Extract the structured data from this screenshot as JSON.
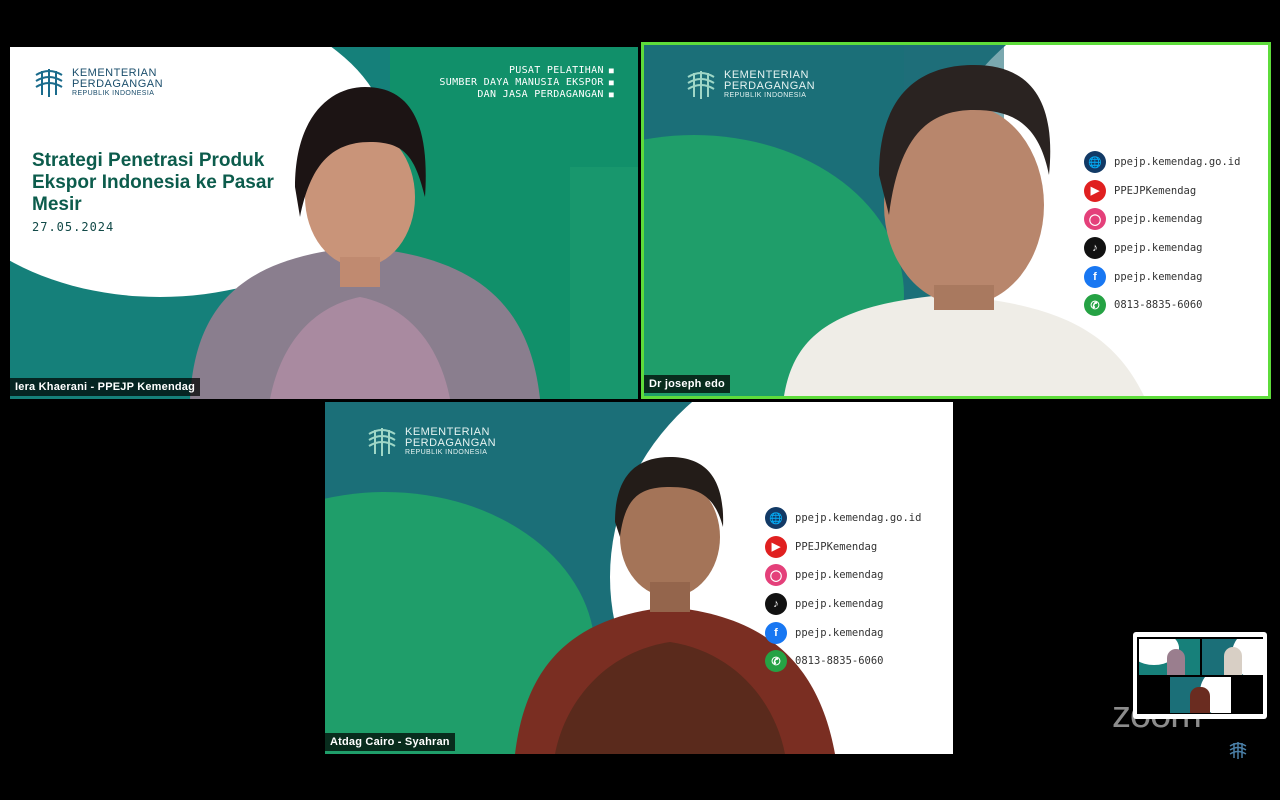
{
  "tiles": {
    "presenter": {
      "name": "Iera Khaerani - PPEJP Kemendag",
      "logo": {
        "line1": "KEMENTERIAN",
        "line2": "PERDAGANGAN",
        "line3": "REPUBLIK INDONESIA"
      },
      "pusat": [
        "PUSAT PELATIHAN",
        "SUMBER DAYA MANUSIA EKSPOR",
        "DAN JASA PERDAGANGAN"
      ],
      "title": [
        "Strategi Penetrasi Produk",
        "Ekspor Indonesia ke Pasar",
        "Mesir"
      ],
      "date": "27.05.2024"
    },
    "speaker": {
      "name": "Dr joseph edo",
      "logo": {
        "line1": "KEMENTERIAN",
        "line2": "PERDAGANGAN",
        "line3": "REPUBLIK INDONESIA"
      },
      "socials": [
        "ppejp.kemendag.go.id",
        "PPEJPKemendag",
        "ppejp.kemendag",
        "ppejp.kemendag",
        "ppejp.kemendag",
        "0813-8835-6060"
      ]
    },
    "guest": {
      "name": "Atdag Cairo - Syahran",
      "logo": {
        "line1": "KEMENTERIAN",
        "line2": "PERDAGANGAN",
        "line3": "REPUBLIK INDONESIA"
      },
      "socials": [
        "ppejp.kemendag.go.id",
        "PPEJPKemendag",
        "ppejp.kemendag",
        "ppejp.kemendag",
        "ppejp.kemendag",
        "0813-8835-6060"
      ]
    }
  },
  "icons": [
    "globe-icon",
    "youtube-icon",
    "instagram-icon",
    "tiktok-icon",
    "facebook-icon",
    "whatsapp-icon"
  ],
  "colors": {
    "active_border": "#5edc3b",
    "teal": "#0e6e73",
    "green": "#1a9b6b"
  },
  "watermark": "zoom"
}
